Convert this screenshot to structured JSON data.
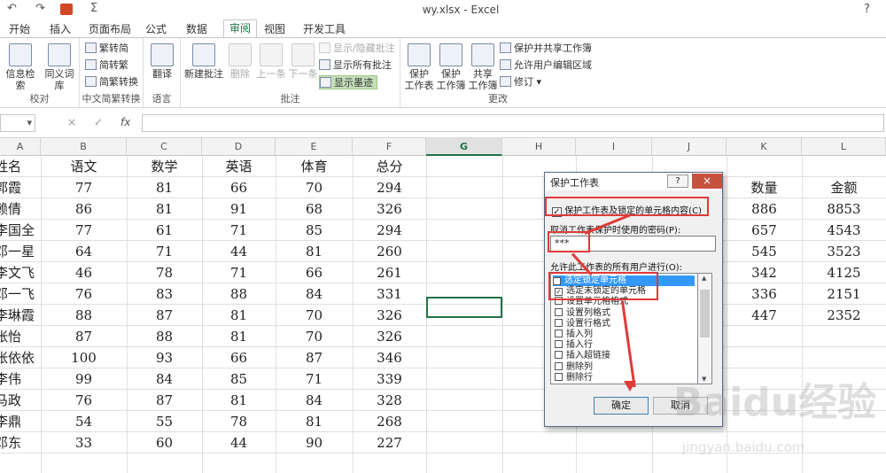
{
  "window": {
    "title": "wy.xlsx - Excel"
  },
  "quick_access": {
    "undo": "↶",
    "redo": "↷",
    "sum": "Σ"
  },
  "tabs": [
    "开始",
    "插入",
    "页面布局",
    "公式",
    "数据",
    "审阅",
    "视图",
    "开发工具"
  ],
  "active_tab": "审阅",
  "ribbon": {
    "proofing": {
      "label": "校对",
      "research": "信息检索",
      "thesaurus": "同义词库"
    },
    "chinese": {
      "label": "中文简繁转换",
      "to_trad": "繁转简",
      "to_simp": "简转繁",
      "convert": "简繁转换"
    },
    "language": {
      "label": "语言",
      "translate": "翻译"
    },
    "comments": {
      "label": "批注",
      "new": "新建批注",
      "delete": "删除",
      "prev": "上一条",
      "next": "下一条",
      "show_hide": "显示/隐藏批注",
      "show_all": "显示所有批注",
      "show_ink": "显示墨迹"
    },
    "changes": {
      "label": "更改",
      "protect_sheet": "保护\n工作表",
      "protect_wb": "保护\n工作簿",
      "share_wb": "共享\n工作簿",
      "protect_share": "保护并共享工作簿",
      "allow_edit": "允许用户编辑区域",
      "track": "修订"
    }
  },
  "formula_bar": {
    "namebox": "",
    "cancel": "×",
    "enter": "✓",
    "fx": "fx",
    "value": ""
  },
  "columns": [
    "A",
    "B",
    "C",
    "D",
    "E",
    "F",
    "G",
    "H",
    "I",
    "J",
    "K",
    "L"
  ],
  "selected_column": "G",
  "headers": [
    "姓名",
    "语文",
    "数学",
    "英语",
    "体育",
    "总分"
  ],
  "rows": [
    [
      "郭霞",
      "77",
      "81",
      "66",
      "70",
      "294"
    ],
    [
      "赖倩",
      "86",
      "81",
      "91",
      "68",
      "326"
    ],
    [
      "李国全",
      "77",
      "61",
      "71",
      "85",
      "294"
    ],
    [
      "邓一星",
      "64",
      "71",
      "44",
      "81",
      "260"
    ],
    [
      "李文飞",
      "46",
      "78",
      "71",
      "66",
      "261"
    ],
    [
      "邓一飞",
      "76",
      "83",
      "88",
      "84",
      "331"
    ],
    [
      "李琳霞",
      "88",
      "87",
      "81",
      "70",
      "326"
    ],
    [
      "张怡",
      "87",
      "88",
      "81",
      "70",
      "326"
    ],
    [
      "张依依",
      "100",
      "93",
      "66",
      "87",
      "346"
    ],
    [
      "李伟",
      "99",
      "84",
      "85",
      "71",
      "339"
    ],
    [
      "马政",
      "76",
      "87",
      "81",
      "84",
      "328"
    ],
    [
      "李鼎",
      "54",
      "55",
      "78",
      "81",
      "268"
    ],
    [
      "邓东",
      "33",
      "60",
      "44",
      "90",
      "227"
    ]
  ],
  "right_table": {
    "headers": [
      "数量",
      "金额"
    ],
    "rows": [
      [
        "886",
        "8853"
      ],
      [
        "657",
        "4543"
      ],
      [
        "545",
        "3523"
      ],
      [
        "342",
        "4125"
      ],
      [
        "336",
        "2151"
      ],
      [
        "447",
        "2352"
      ]
    ]
  },
  "dialog": {
    "title": "保护工作表",
    "help": "?",
    "close": "×",
    "protect_checkbox": "保护工作表及锁定的单元格内容(C)",
    "password_label": "取消工作表保护时使用的密码(P):",
    "password_value": "***",
    "allow_label": "允许此工作表的所有用户进行(O):",
    "permissions": [
      {
        "label": "选定锁定单元格",
        "checked": true
      },
      {
        "label": "选定未锁定的单元格",
        "checked": true
      },
      {
        "label": "设置单元格格式",
        "checked": false
      },
      {
        "label": "设置列格式",
        "checked": false
      },
      {
        "label": "设置行格式",
        "checked": false
      },
      {
        "label": "插入列",
        "checked": false
      },
      {
        "label": "插入行",
        "checked": false
      },
      {
        "label": "插入超链接",
        "checked": false
      },
      {
        "label": "删除列",
        "checked": false
      },
      {
        "label": "删除行",
        "checked": false
      }
    ],
    "ok": "确定",
    "cancel": "取消"
  },
  "watermark": {
    "text": "Baidu经验",
    "url": "jingyan.baidu.com"
  },
  "colors": {
    "excel_green": "#217346",
    "highlight_red": "#e03a3a",
    "selection_blue": "#3399ff"
  }
}
